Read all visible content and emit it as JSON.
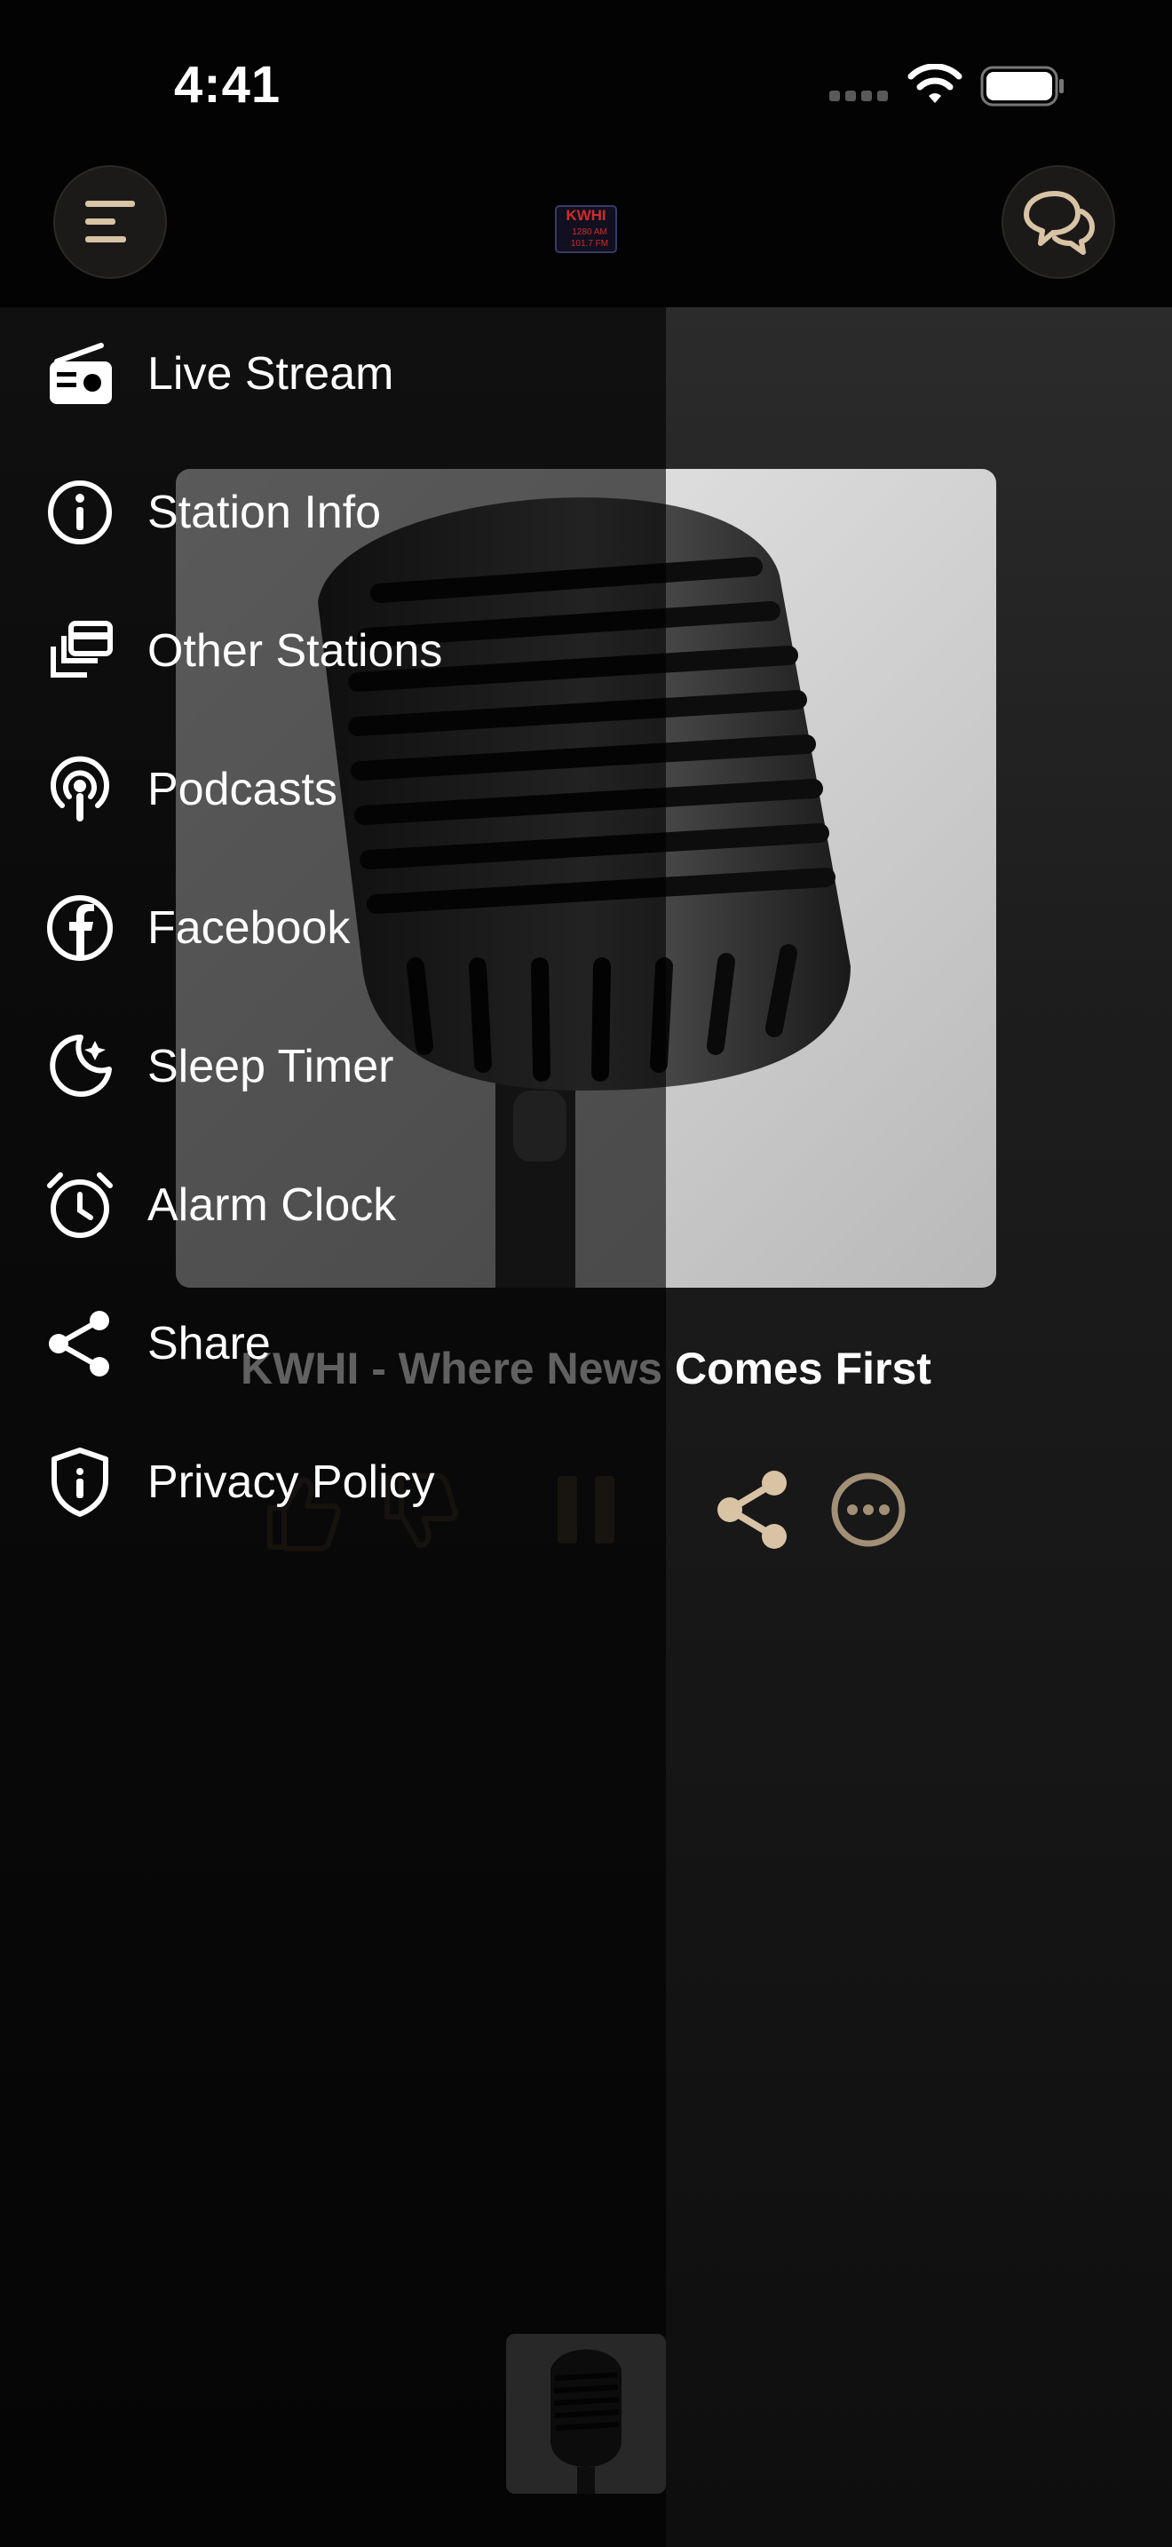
{
  "status_bar": {
    "time": "4:41"
  },
  "header": {
    "menu_icon": "menu-icon",
    "chat_icon": "chat-bubbles-icon",
    "logo_text": "KWHI",
    "logo_sub": [
      "1280 AM",
      "101.7 FM"
    ]
  },
  "player": {
    "track_title": "KWHI - Where News Comes First",
    "controls": [
      "thumbs-up-icon",
      "thumbs-down-icon",
      "pause-icon",
      "share-icon",
      "more-icon"
    ]
  },
  "drawer": {
    "items": [
      {
        "label": "Live Stream",
        "icon": "radio-icon"
      },
      {
        "label": "Station Info",
        "icon": "info-icon"
      },
      {
        "label": "Other Stations",
        "icon": "stack-icon"
      },
      {
        "label": "Podcasts",
        "icon": "podcast-icon"
      },
      {
        "label": "Facebook",
        "icon": "facebook-icon"
      },
      {
        "label": "Sleep Timer",
        "icon": "moon-icon"
      },
      {
        "label": "Alarm Clock",
        "icon": "alarm-clock-icon"
      },
      {
        "label": "Share",
        "icon": "share-icon"
      },
      {
        "label": "Privacy Policy",
        "icon": "shield-icon"
      }
    ]
  },
  "colors": {
    "accent": "#d9c3a5",
    "background": "#000000",
    "drawer_text": "#ffffff"
  }
}
